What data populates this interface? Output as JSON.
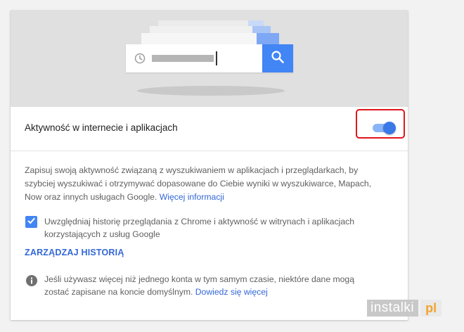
{
  "settings_card": {
    "toggle_row": {
      "title": "Aktywność w internecie i aplikacjach",
      "toggle_state": "on",
      "toggle_track_color": "#8ab4f8",
      "toggle_thumb_color": "#3b78e7",
      "highlight_color": "#e0151b"
    },
    "description": {
      "text": "Zapisuj swoją aktywność związaną z wyszukiwaniem w aplikacjach i przeglądarkach, by szybciej wyszukiwać i otrzymywać dopasowane do Ciebie wyniki w wyszukiwarce, Mapach, Now oraz innych usługach Google.",
      "link": "Więcej informacji"
    },
    "chrome_history_checkbox": {
      "checked": true,
      "label": "Uwzględniaj historię przeglądania z Chrome i aktywność w witrynach i aplikacjach korzystających z usług Google"
    },
    "manage_history_link": "ZARZĄDZAJ HISTORIĄ",
    "info_note": {
      "text": "Jeśli używasz więcej niż jednego konta w tym samym czasie, niektóre dane mogą zostać zapisane na koncie domyślnym.",
      "link": "Dowiedz się więcej"
    }
  },
  "illustration": {
    "icons": [
      "clock-icon",
      "search-icon"
    ],
    "search_button_color": "#4285f4"
  },
  "watermark": {
    "brand": "instalki",
    "suffix": "pl"
  }
}
